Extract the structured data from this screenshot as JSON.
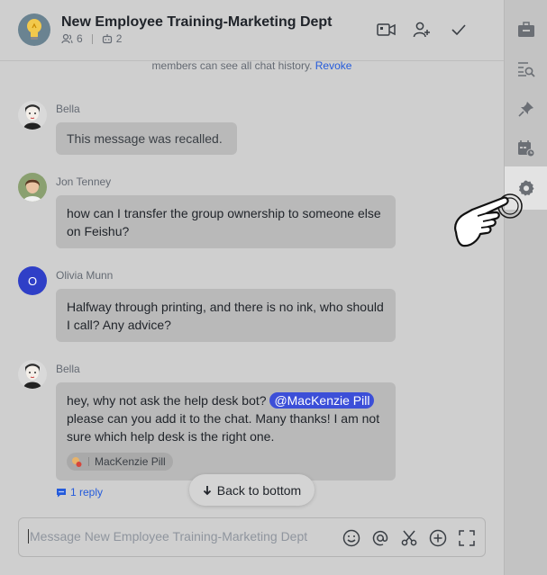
{
  "header": {
    "title": "New Employee Training-Marketing Dept",
    "member_count": "6",
    "bot_count": "2"
  },
  "notice": {
    "text": "members can see all chat history.",
    "link": "Revoke"
  },
  "messages": [
    {
      "sender": "Bella",
      "text": "This message was recalled."
    },
    {
      "sender": "Jon Tenney",
      "text": "how can I transfer the group ownership to someone else on Feishu?"
    },
    {
      "sender": "Olivia Munn",
      "avatar_initial": "O",
      "text": "Halfway through printing, and there is no ink, who should I call? Any advice?"
    },
    {
      "sender": "Bella",
      "text_before": "hey, why not ask the help desk bot?",
      "mention": "@MacKenzie Pill",
      "text_after": "please can you add it to the chat. Many thanks! I am not sure which help desk is the right one.",
      "chip_label": "MacKenzie Pill"
    }
  ],
  "reply": {
    "label": "1 reply"
  },
  "back_to_bottom": {
    "label": "Back to bottom"
  },
  "composer": {
    "placeholder": "Message New Employee Training-Marketing Dept"
  },
  "colors": {
    "accent": "#245bdb",
    "mention_bg": "#3c4fd8",
    "olivia_avatar": "#2f3fc7"
  },
  "icons": {
    "header": [
      "video-call-icon",
      "add-member-icon",
      "checkmark-icon"
    ],
    "composer": [
      "emoji-icon",
      "mention-icon",
      "scissors-icon",
      "plus-circle-icon",
      "expand-icon"
    ],
    "sidebar": [
      "briefcase-icon",
      "search-history-icon",
      "pin-icon",
      "calendar-icon",
      "settings-gear-icon"
    ]
  }
}
